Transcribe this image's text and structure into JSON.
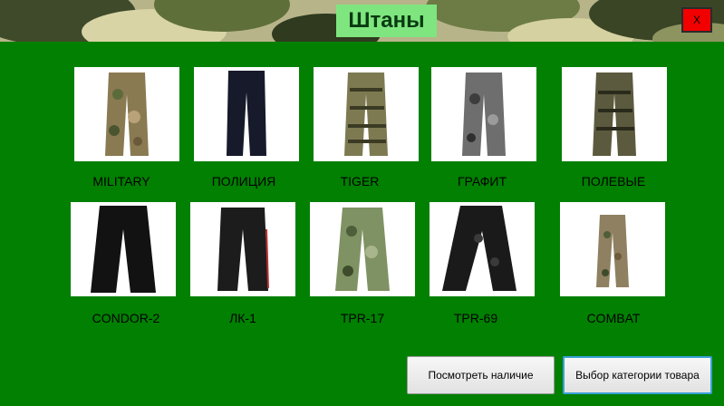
{
  "window": {
    "title": "Штаны",
    "close_label": "X"
  },
  "colors": {
    "background": "#018001",
    "title_bg": "#7fe67f",
    "close_bg": "#f20000"
  },
  "products": [
    {
      "label": "MILITARY",
      "pattern": "multicam"
    },
    {
      "label": "ПОЛИЦИЯ",
      "pattern": "navy"
    },
    {
      "label": "TIGER",
      "pattern": "tiger"
    },
    {
      "label": "ГРАФИТ",
      "pattern": "grey-camo"
    },
    {
      "label": "ПОЛЕВЫЕ",
      "pattern": "tiger-dark"
    },
    {
      "label": "CONDOR-2",
      "pattern": "black"
    },
    {
      "label": "ЛК-1",
      "pattern": "black-stripe"
    },
    {
      "label": "TPR-17",
      "pattern": "green-camo"
    },
    {
      "label": "TPR-69",
      "pattern": "black-camo"
    },
    {
      "label": "COMBAT",
      "pattern": "woodland"
    }
  ],
  "buttons": {
    "check_availability": "Посмотреть наличие",
    "select_category": "Выбор категории товара"
  }
}
